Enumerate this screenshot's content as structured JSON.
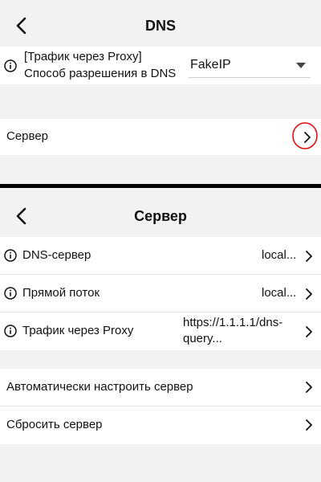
{
  "screen1": {
    "title": "DNS",
    "dns_mode_label_line1": "[Трафик через Proxy]",
    "dns_mode_label_line2": "Способ разрешения в DNS",
    "dns_mode_value": "FakeIP",
    "server_label": "Сервер"
  },
  "screen2": {
    "title": "Сервер",
    "rows": [
      {
        "label": "DNS-сервер",
        "value": "local..."
      },
      {
        "label": "Прямой поток",
        "value": "local..."
      },
      {
        "label": "Трафик через Proxy",
        "value_line1": "https://1.1.1.1/dns-",
        "value_line2": "query..."
      }
    ],
    "actions": [
      {
        "label": "Автоматически настроить сервер"
      },
      {
        "label": "Сбросить сервер"
      }
    ]
  },
  "colors": {
    "background": "#f2f2f2",
    "card": "#ffffff",
    "highlight_circle": "#e01010",
    "separator": "#000000"
  },
  "icons": {
    "back": "chevron-left-icon",
    "info": "info-circle-icon",
    "chevron": "chevron-right-icon",
    "dropdown": "caret-down-icon"
  }
}
